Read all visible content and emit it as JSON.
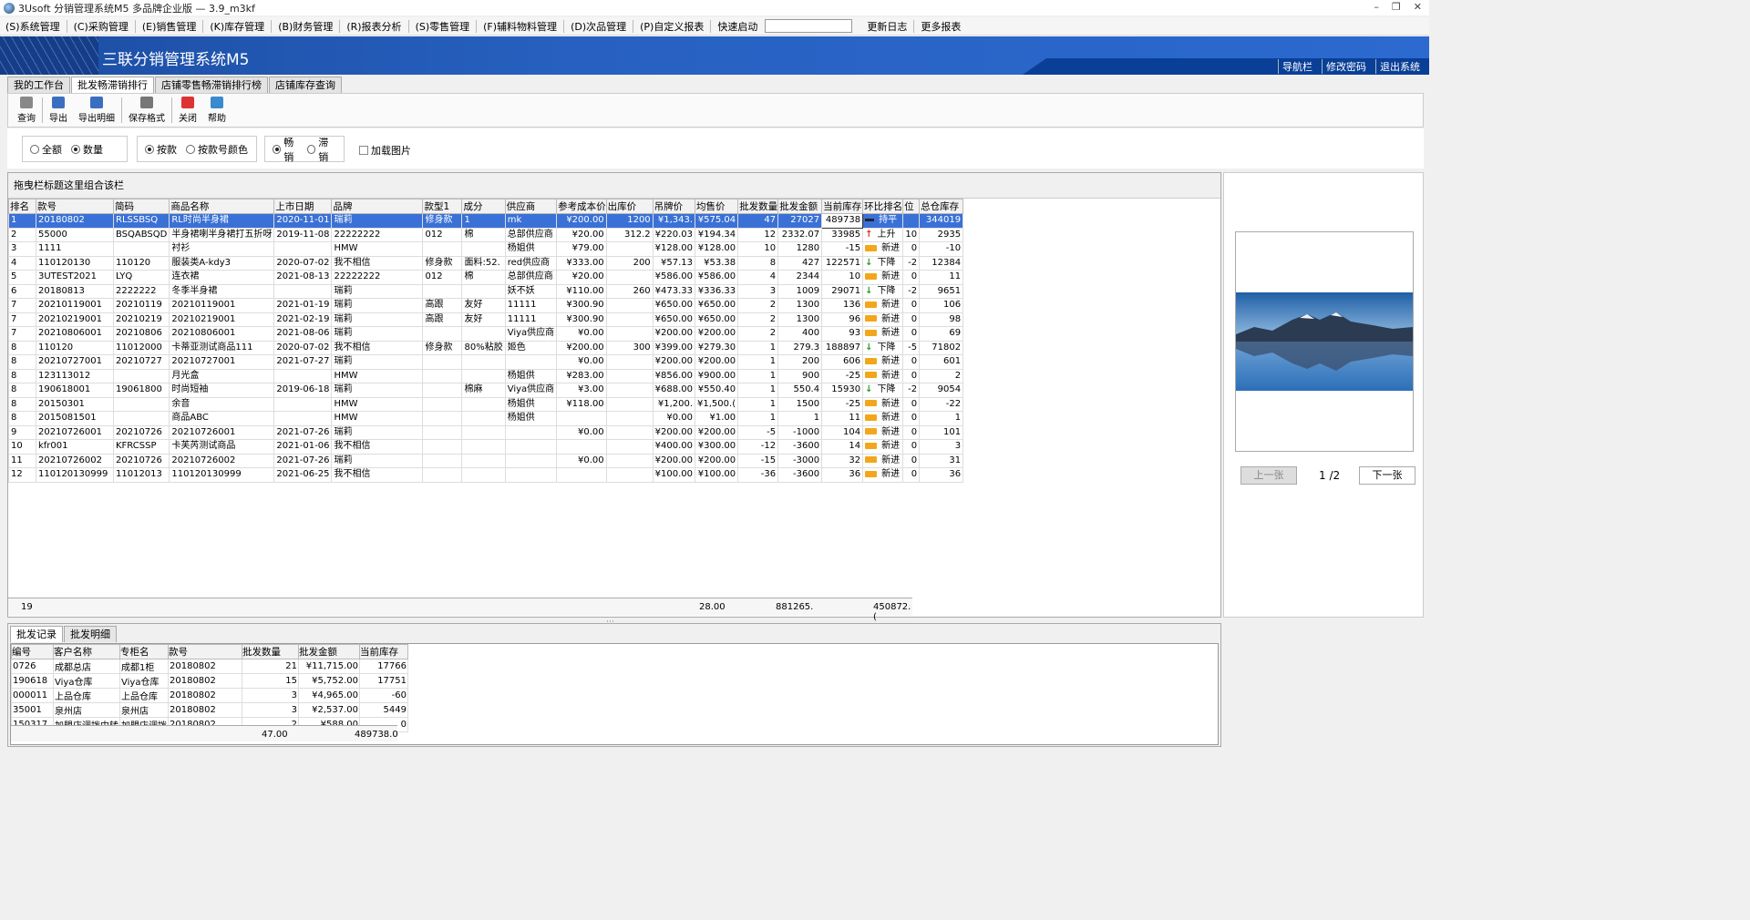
{
  "window": {
    "title": "3Usoft 分销管理系统M5 多品牌企业版 — 3.9_m3kf",
    "controls": [
      "–",
      "❐",
      "✕"
    ]
  },
  "menu": [
    "(S)系统管理",
    "(C)采购管理",
    "(E)销售管理",
    "(K)库存管理",
    "(B)财务管理",
    "(R)报表分析",
    "(S)零售管理",
    "(F)辅料物料管理",
    "(D)次品管理",
    "(P)自定义报表"
  ],
  "quick_label": "快速启动",
  "menu_right": [
    "更新日志",
    "更多报表"
  ],
  "banner": {
    "title": "三联分销管理系统M5",
    "links": [
      "导航栏",
      "修改密码",
      "退出系统"
    ]
  },
  "tabs": [
    "我的工作台",
    "批发畅滞销排行",
    "店铺零售畅滞销排行榜",
    "店铺库存查询"
  ],
  "toolbar": [
    {
      "label": "查询",
      "icon": "query-icon",
      "color": "#888"
    },
    {
      "label": "导出",
      "icon": "export-icon",
      "color": "#3a6fc0"
    },
    {
      "label": "导出明细",
      "icon": "export-detail-icon",
      "color": "#3a6fc0"
    },
    {
      "label": "保存格式",
      "icon": "save-format-icon",
      "color": "#777"
    },
    {
      "label": "关闭",
      "icon": "close-icon",
      "color": "#d33"
    },
    {
      "label": "帮助",
      "icon": "help-icon",
      "color": "#3a8ad0"
    }
  ],
  "filters": {
    "g1": [
      "全额",
      "数量"
    ],
    "g2": [
      "按款",
      "按款号颜色"
    ],
    "g3": [
      "畅销",
      "滞销"
    ],
    "load_images": "加载图片"
  },
  "group_hint": "拖曳栏标题这里组合该栏",
  "columns": [
    "排名",
    "款号",
    "简码",
    "商品名称",
    "上市日期",
    "品牌",
    "款型1",
    "成分",
    "供应商",
    "参考成本价",
    "出库价",
    "吊牌价",
    "均售价",
    "批发数量",
    "批发金额",
    "当前库存",
    "环比排名",
    "位",
    "总仓库存"
  ],
  "rows": [
    [
      "1",
      "20180802",
      "RLSSBSQ",
      "RL时尚半身裙",
      "2020-11-01",
      "瑞莉",
      "修身款",
      "1",
      "mk",
      "¥200.00",
      "1200",
      "¥1,343.",
      "¥575.04",
      "47",
      "27027",
      "489738",
      "flat",
      "持平",
      "",
      "344019"
    ],
    [
      "2",
      "55000",
      "BSQABSQD",
      "半身裙喇半身裙打五折呀",
      "2019-11-08",
      "22222222",
      "012",
      "棉",
      "总部供应商",
      "¥20.00",
      "312.2",
      "¥220.03",
      "¥194.34",
      "12",
      "2332.07",
      "33985",
      "up",
      "上升",
      "10",
      "2935"
    ],
    [
      "3",
      "1111",
      "",
      "衬衫",
      "",
      "HMW",
      "",
      "",
      "杨姐供",
      "¥79.00",
      "",
      "¥128.00",
      "¥128.00",
      "10",
      "1280",
      "-15",
      "new",
      "新进",
      "0",
      "-10"
    ],
    [
      "4",
      "110120130",
      "110120",
      "服装类A-kdy3",
      "2020-07-02",
      "我不相信",
      "修身款",
      "面料:52.",
      "red供应商",
      "¥333.00",
      "200",
      "¥57.13",
      "¥53.38",
      "8",
      "427",
      "122571",
      "down",
      "下降",
      "-2",
      "12384"
    ],
    [
      "5",
      "3UTEST2021",
      "LYQ",
      "连衣裙",
      "2021-08-13",
      "22222222",
      "012",
      "棉",
      "总部供应商",
      "¥20.00",
      "",
      "¥586.00",
      "¥586.00",
      "4",
      "2344",
      "10",
      "new",
      "新进",
      "0",
      "11"
    ],
    [
      "6",
      "20180813",
      "2222222",
      "冬季半身裙",
      "",
      "瑞莉",
      "",
      "",
      "妖不妖",
      "¥110.00",
      "260",
      "¥473.33",
      "¥336.33",
      "3",
      "1009",
      "29071",
      "down",
      "下降",
      "-2",
      "9651"
    ],
    [
      "7",
      "20210119001",
      "20210119",
      "20210119001",
      "2021-01-19",
      "瑞莉",
      "高跟",
      "友好",
      "11111",
      "¥300.90",
      "",
      "¥650.00",
      "¥650.00",
      "2",
      "1300",
      "136",
      "new",
      "新进",
      "0",
      "106"
    ],
    [
      "7",
      "20210219001",
      "20210219",
      "20210219001",
      "2021-02-19",
      "瑞莉",
      "高跟",
      "友好",
      "11111",
      "¥300.90",
      "",
      "¥650.00",
      "¥650.00",
      "2",
      "1300",
      "96",
      "new",
      "新进",
      "0",
      "98"
    ],
    [
      "7",
      "20210806001",
      "20210806",
      "20210806001",
      "2021-08-06",
      "瑞莉",
      "",
      "",
      "Viya供应商",
      "¥0.00",
      "",
      "¥200.00",
      "¥200.00",
      "2",
      "400",
      "93",
      "new",
      "新进",
      "0",
      "69"
    ],
    [
      "8",
      "110120",
      "11012000",
      "卡蒂亚测试商品111",
      "2020-07-02",
      "我不相信",
      "修身款",
      "80%粘胶",
      "姬色",
      "¥200.00",
      "300",
      "¥399.00",
      "¥279.30",
      "1",
      "279.3",
      "188897",
      "down",
      "下降",
      "-5",
      "71802"
    ],
    [
      "8",
      "20210727001",
      "20210727",
      "20210727001",
      "2021-07-27",
      "瑞莉",
      "",
      "",
      "",
      "¥0.00",
      "",
      "¥200.00",
      "¥200.00",
      "1",
      "200",
      "606",
      "new",
      "新进",
      "0",
      "601"
    ],
    [
      "8",
      "123113012",
      "",
      "月光盒",
      "",
      "HMW",
      "",
      "",
      "杨姐供",
      "¥283.00",
      "",
      "¥856.00",
      "¥900.00",
      "1",
      "900",
      "-25",
      "new",
      "新进",
      "0",
      "2"
    ],
    [
      "8",
      "190618001",
      "19061800",
      "时尚短袖",
      "2019-06-18",
      "瑞莉",
      "",
      "棉麻",
      "Viya供应商",
      "¥3.00",
      "",
      "¥688.00",
      "¥550.40",
      "1",
      "550.4",
      "15930",
      "down",
      "下降",
      "-2",
      "9054"
    ],
    [
      "8",
      "20150301",
      "",
      "余音",
      "",
      "HMW",
      "",
      "",
      "杨姐供",
      "¥118.00",
      "",
      "¥1,200.",
      "¥1,500.(",
      "1",
      "1500",
      "-25",
      "new",
      "新进",
      "0",
      "-22"
    ],
    [
      "8",
      "2015081501",
      "",
      "商品ABC",
      "",
      "HMW",
      "",
      "",
      "杨姐供",
      "",
      "",
      "¥0.00",
      "¥1.00",
      "1",
      "1",
      "11",
      "new",
      "新进",
      "0",
      "1"
    ],
    [
      "9",
      "20210726001",
      "20210726",
      "20210726001",
      "2021-07-26",
      "瑞莉",
      "",
      "",
      "",
      "¥0.00",
      "",
      "¥200.00",
      "¥200.00",
      "-5",
      "-1000",
      "104",
      "new",
      "新进",
      "0",
      "101"
    ],
    [
      "10",
      "kfr001",
      "KFRCSSP",
      "卡芙芮测试商品",
      "2021-01-06",
      "我不相信",
      "",
      "",
      "",
      "",
      "",
      "¥400.00",
      "¥300.00",
      "-12",
      "-3600",
      "14",
      "new",
      "新进",
      "0",
      "3"
    ],
    [
      "11",
      "20210726002",
      "20210726",
      "20210726002",
      "2021-07-26",
      "瑞莉",
      "",
      "",
      "",
      "¥0.00",
      "",
      "¥200.00",
      "¥200.00",
      "-15",
      "-3000",
      "32",
      "new",
      "新进",
      "0",
      "31"
    ],
    [
      "12",
      "110120130999",
      "11012013",
      "110120130999",
      "2021-06-25",
      "我不相信",
      "",
      "",
      "",
      "",
      "",
      "¥100.00",
      "¥100.00",
      "-36",
      "-3600",
      "36",
      "new",
      "新进",
      "0",
      "36"
    ]
  ],
  "footer": {
    "count": "19",
    "qty": "28.00",
    "amount": "881265.",
    "stock": "450872.("
  },
  "image_pager": {
    "prev": "上一张",
    "page": "1 /2",
    "next": "下一张"
  },
  "bottom_tabs": [
    "批发记录",
    "批发明细"
  ],
  "sub_columns": [
    "编号",
    "客户名称",
    "专柜名",
    "款号",
    "批发数量",
    "批发金额",
    "当前库存"
  ],
  "sub_rows": [
    [
      "0726",
      "成都总店",
      "成都1柜",
      "20180802",
      "21",
      "¥11,715.00",
      "17766"
    ],
    [
      "190618",
      "Viya仓库",
      "Viya仓库",
      "20180802",
      "15",
      "¥5,752.00",
      "17751"
    ],
    [
      "000011",
      "上品仓库",
      "上品仓库",
      "20180802",
      "3",
      "¥4,965.00",
      "-60"
    ],
    [
      "35001",
      "泉州店",
      "泉州店",
      "20180802",
      "3",
      "¥2,537.00",
      "5449"
    ],
    [
      "150317",
      "加盟店调拨中转",
      "加盟店调拨",
      "20180802",
      "2",
      "¥588.00",
      "0"
    ]
  ],
  "sub_footer": {
    "qty": "47.00",
    "stock": "489738.0"
  }
}
